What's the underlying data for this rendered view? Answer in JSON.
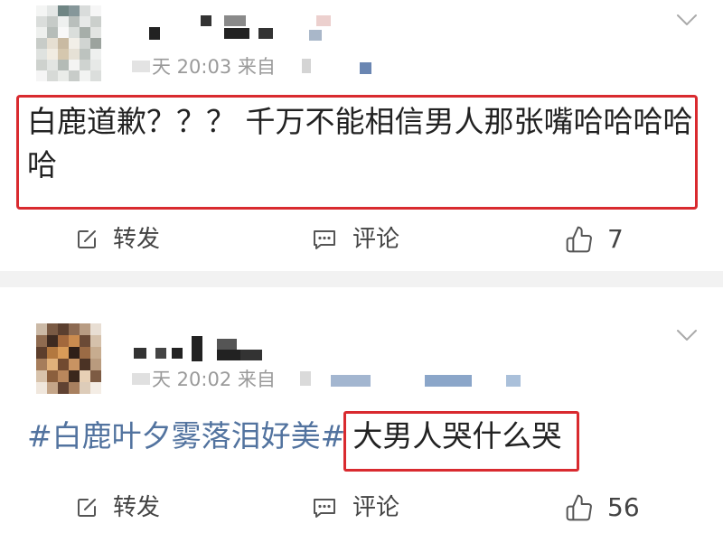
{
  "feed": {
    "posts": [
      {
        "timestamp": "天 20:03 来自",
        "text": "白鹿道歉？？？ 千万不能相信男人那张嘴哈哈哈哈哈",
        "menu_icon": "chevron-down-icon",
        "actions": {
          "repost": {
            "label": "转发",
            "icon": "share-icon"
          },
          "comment": {
            "label": "评论",
            "icon": "comment-icon"
          },
          "like": {
            "count": "7",
            "icon": "thumbs-up-icon"
          }
        }
      },
      {
        "timestamp": "天 20:02 来自",
        "hashtag": "#白鹿叶夕雾落泪好美#",
        "text": "大男人哭什么哭",
        "menu_icon": "chevron-down-icon",
        "actions": {
          "repost": {
            "label": "转发",
            "icon": "share-icon"
          },
          "comment": {
            "label": "评论",
            "icon": "comment-icon"
          },
          "like": {
            "count": "56",
            "icon": "thumbs-up-icon"
          }
        }
      }
    ]
  },
  "colors": {
    "highlight_red": "#d92a2f",
    "hashtag_blue": "#52739f",
    "text": "#222222",
    "meta_gray": "#9a9a9a",
    "action_gray": "#444444",
    "divider": "#f2f2f2"
  }
}
